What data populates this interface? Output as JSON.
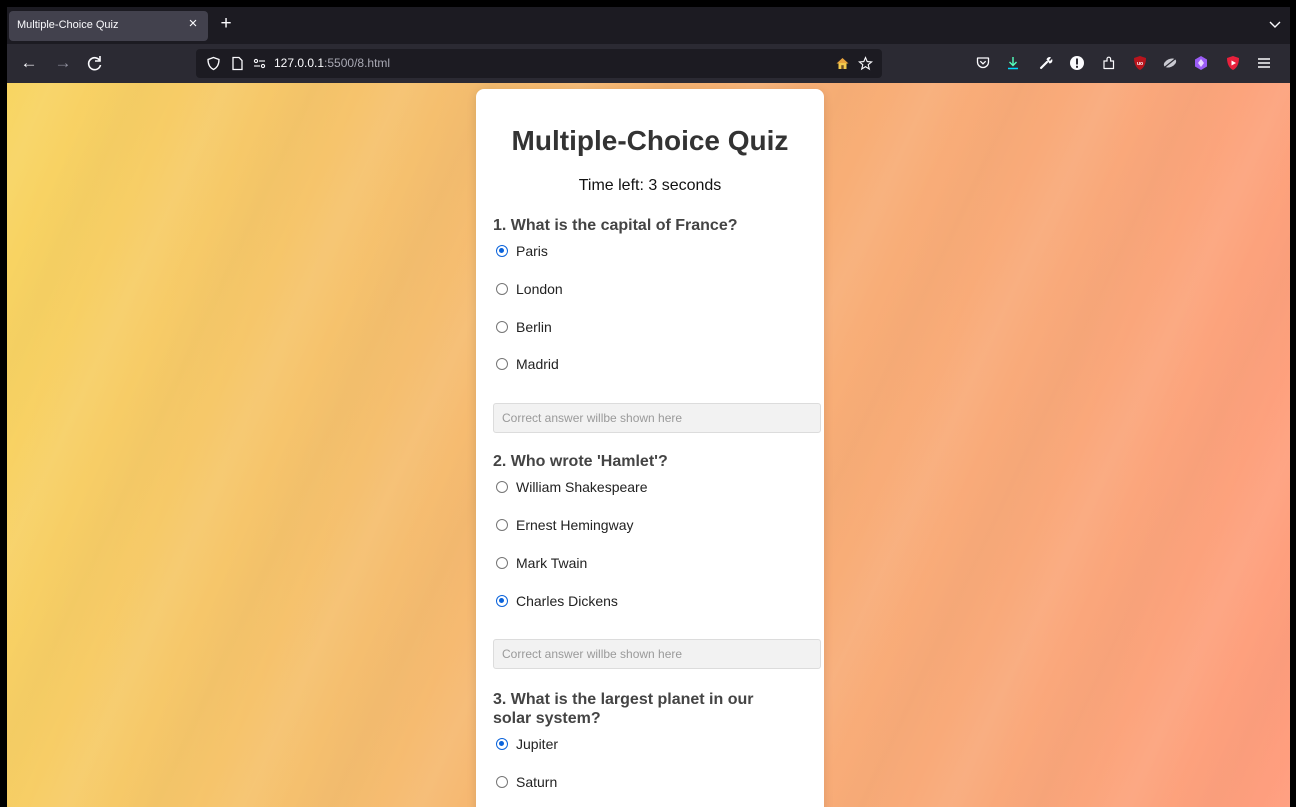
{
  "browser": {
    "tab": {
      "title": "Multiple-Choice Quiz",
      "close": "×"
    },
    "new_tab": "+",
    "nav": {
      "back": "←",
      "forward": "→",
      "reload": "C"
    },
    "url": {
      "host": "127.0.0.1",
      "path": ":5500/8.html"
    },
    "icons": [
      "shield-icon",
      "page-icon",
      "permissions-icon",
      "home-icon",
      "bookmark-star-icon",
      "pocket-icon",
      "download-icon",
      "wrench-icon",
      "info-icon",
      "extensions-icon",
      "ublock-icon",
      "ext-icon",
      "ext-purple-icon",
      "ext-red-icon",
      "menu-icon"
    ]
  },
  "quiz": {
    "title": "Multiple-Choice Quiz",
    "timer": "Time left: 3 seconds",
    "answer_placeholder": "Correct answer willbe shown here",
    "questions": [
      {
        "text": "1. What is the capital of France?",
        "options": [
          "Paris",
          "London",
          "Berlin",
          "Madrid"
        ],
        "selected": "Paris"
      },
      {
        "text": "2. Who wrote 'Hamlet'?",
        "options": [
          "William Shakespeare",
          "Ernest Hemingway",
          "Mark Twain",
          "Charles Dickens"
        ],
        "selected": "Charles Dickens"
      },
      {
        "text": "3. What is the largest planet in our solar system?",
        "options": [
          "Jupiter",
          "Saturn"
        ],
        "selected": "Jupiter"
      }
    ]
  },
  "colors": {
    "accent": "#0a63db",
    "title": "#333333",
    "question": "#444444"
  }
}
